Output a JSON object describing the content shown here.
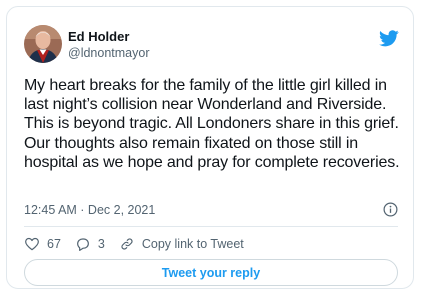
{
  "tweet": {
    "author_name": "Ed Holder",
    "author_handle": "@ldnontmayor",
    "text": "My heart breaks for the family of the little girl killed in last night’s collision near Wonderland and Riverside. This is beyond tragic. All Londoners share in this grief. Our thoughts also remain fixated on those still in hospital as we hope and pray for complete recoveries.",
    "timestamp": "12:45 AM · Dec 2, 2021"
  },
  "actions": {
    "likes": "67",
    "replies": "3",
    "copy_link_label": "Copy link to Tweet"
  },
  "reply_button_label": "Tweet your reply",
  "icons": {
    "brand": "twitter-bird-icon",
    "info": "info-icon",
    "like": "heart-icon",
    "reply": "reply-bubble-icon",
    "link": "link-icon"
  },
  "colors": {
    "brand_blue": "#1d9bf0",
    "secondary_text": "#536471",
    "border": "#e1e8ed"
  }
}
